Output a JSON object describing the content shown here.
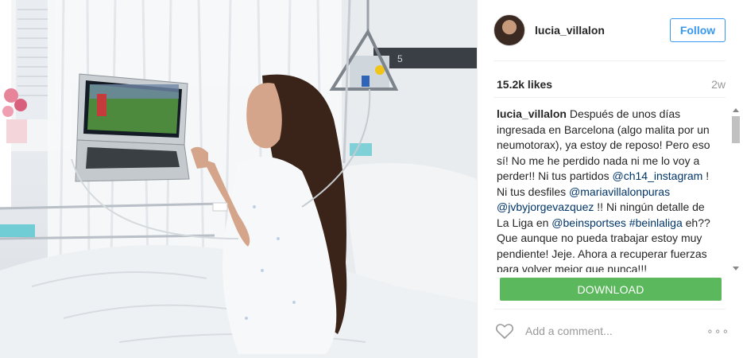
{
  "post": {
    "image_alt": "Woman in hospital bed holding a laptop showing a football match",
    "header": {
      "username": "lucia_villalon",
      "follow_label": "Follow"
    },
    "likes": "15.2k likes",
    "time": "2w",
    "caption": {
      "username": "lucia_villalon",
      "t1": " Después de unos días ingresada en Barcelona (algo malita por un neumotorax), ya estoy de reposo! Pero eso sí! No me he perdido nada ni me lo voy a perder!! Ni tus partidos ",
      "m1": "@ch14_instagram",
      "t2": " ! Ni tus desfiles ",
      "m2": "@mariavillalonpuras",
      "t3": " ",
      "m3": "@jvbyjorgevazquez",
      "t4": " !! Ni ningún detalle de La Liga en ",
      "m4": "@beinsportses",
      "t5": " ",
      "m5": "#beinlaliga",
      "t6": " eh?? Que aunque no pueda trabajar estoy muy pendiente! Jeje. Ahora a recuperar fuerzas para volver mejor que nunca!!!"
    },
    "download_label": "DOWNLOAD",
    "comment_placeholder": "Add a comment...",
    "more_label": "∘∘∘"
  },
  "colors": {
    "follow": "#3897f0",
    "download": "#5cb85c",
    "link": "#003569"
  },
  "icons": {
    "like": "heart-icon",
    "avatar": "profile-picture",
    "more": "more-options-icon"
  }
}
